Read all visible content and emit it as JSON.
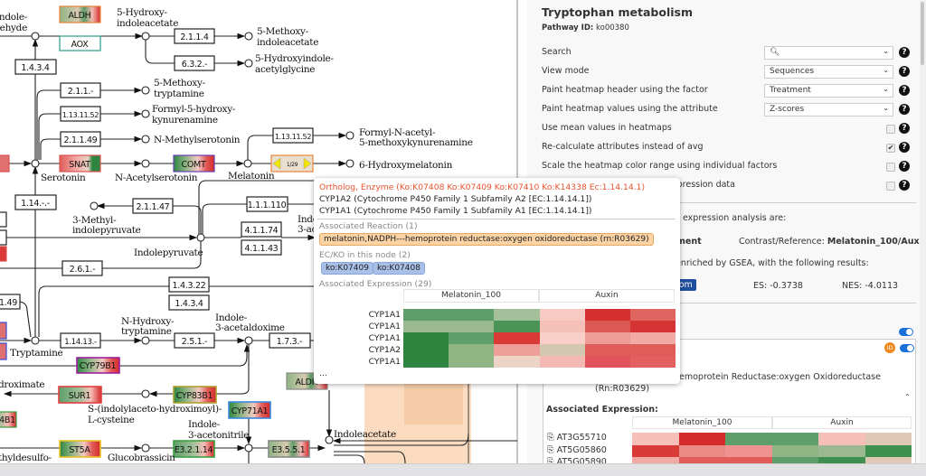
{
  "map": {
    "enzymes": [
      "ALDH",
      "AOX",
      "1.4.3.4",
      "2.1.1.4",
      "6.3.2.-",
      "2.1.1.-",
      "1.13.11.52",
      "2.1.1.49",
      "SNAT",
      "COMT",
      "1.13.11.52",
      "1/29",
      "1.14.-.-",
      "2.1.1.47",
      "1.1.1.110",
      "4.1.1.74",
      "4.1.1.43",
      "2.6.1.-",
      "1.4.3.22",
      "1.4.3.4",
      "1.14.13.-",
      "2.5.1.-",
      "1.7.3.-",
      "CYP79B1",
      "SUR1",
      "CYP83B1",
      "CYP71A1",
      "ST5A",
      "E3.2.1.14",
      "E3.5.5.1",
      "ALDH",
      "4B1",
      "1.49"
    ],
    "compounds": [
      [
        "roxyindole-",
        "dehyde"
      ],
      [
        "5-Hydroxy-",
        "indoleacetate"
      ],
      [
        "5-Methoxy-",
        "indoleacetate"
      ],
      [
        "5-Hydroxyindole-",
        "acetylglycine"
      ],
      [
        "5-Methoxy-",
        "tryptamine"
      ],
      [
        "Formyl-5-hydroxy-",
        "kynurenamine"
      ],
      [
        "N-Methylserotonin"
      ],
      [
        "Serotonin"
      ],
      [
        "N-Acetylserotonin"
      ],
      [
        "Melatonin"
      ],
      [
        "Formyl-N-acetyl-",
        "5-methoxykynurenamine"
      ],
      [
        "6-Hydroxymelatonin"
      ],
      [
        "3-Methyl-",
        "indolepyruvate"
      ],
      [
        "Indolepyruvate"
      ],
      [
        "Indo",
        "3-ac"
      ],
      [
        "N-Hydroxy-",
        "tryptamine"
      ],
      [
        "Indole-",
        "3-acetaldoxime"
      ],
      [
        "Tryptamine"
      ],
      [
        "droximate"
      ],
      [
        "S-(indolylaceto-hydroximoyl)-",
        "L-cysteine"
      ],
      [
        "Indole-",
        "3-acetonitrile"
      ],
      [
        "thyldesulfo-"
      ],
      [
        "Glucobrassicin"
      ],
      [
        "Indoleacetate"
      ]
    ]
  },
  "tooltip": {
    "header": "Ortholog, Enzyme  (Ko:K07408 Ko:K07409 Ko:K07410 Ko:K14338 Ec:1.14.14.1)",
    "genes": [
      "CYP1A2 (Cytochrome P450 Family 1 Subfamily A2 [EC:1.14.14.1])",
      "CYP1A1 (Cytochrome P450 Family 1 Subfamily A1 [EC:1.14.14.1])"
    ],
    "reaction_title": "Associated Reaction (1)",
    "reaction": "melatonin,NADPH---hemoprotein reductase:oxygen oxidoreductase (rn:R03629)",
    "ecko_title": "EC/KO in this node (2)",
    "ecko": [
      "ko:K07409",
      "ko:K07408"
    ],
    "expression_title": "Associated Expression (29)",
    "groups": [
      "Melatonin_100",
      "Auxin"
    ],
    "rows": [
      "CYP1A1",
      "CYP1A1",
      "CYP1A1",
      "CYP1A2",
      "CYP1A1"
    ],
    "heatmap": [
      [
        "#5e9e6a",
        "#5e9e6a",
        "#a3c09a",
        "#f7cbc3",
        "#d62f2f",
        "#e06560"
      ],
      [
        "#9ab990",
        "#9ab990",
        "#4a9458",
        "#f5c0b8",
        "#dc5a55",
        "#d63434"
      ],
      [
        "#2e8540",
        "#5e9e6a",
        "#d93a36",
        "#f8d0c8",
        "#ed9c96",
        "#f2aaa4"
      ],
      [
        "#2e8540",
        "#8fb585",
        "#ef9f9a",
        "#d4c7b0",
        "#e05c58",
        "#e05c58"
      ],
      [
        "#2e8540",
        "#8fb585",
        "#ecd4c7",
        "#f3b9b3",
        "#e0535a",
        "#e26060"
      ]
    ],
    "more": "..."
  },
  "panel": {
    "title": "Tryptophan metabolism",
    "pathway_id_label": "Pathway ID:",
    "pathway_id": "ko00380",
    "settings": [
      {
        "label": "Search",
        "type": "select",
        "value": "",
        "icon": "search-icon"
      },
      {
        "label": "View mode",
        "type": "select",
        "value": "Sequences"
      },
      {
        "label": "Paint heatmap header using the factor",
        "type": "select",
        "value": "Treatment"
      },
      {
        "label": "Paint heatmap values using the attribute",
        "type": "select",
        "value": "Z-scores"
      },
      {
        "label": "Use mean values in heatmaps",
        "type": "checkbox",
        "checked": false
      },
      {
        "label": "Re-calculate attributes instead of avg",
        "type": "checkbox",
        "checked": true
      },
      {
        "label": "Scale the heatmap color range using individual factors",
        "type": "checkbox",
        "checked": false
      },
      {
        "label": "xpression data",
        "type": "checkbox",
        "checked": false
      }
    ],
    "analysis_intro": "expression analysis are:",
    "factor_fragment": "ment",
    "contrast_label": "Contrast/Reference:",
    "contrast_value": "Melatonin_100/Auxin",
    "gsea_text": "enriched by GSEA, with the following results:",
    "badge": "tom",
    "es": "ES: -0.3738",
    "nes": "NES: -4.0113",
    "card": {
      "id_badge": "ID",
      "reaction_fragment": "emoprotein Reductase:oxygen Oxidoreductase",
      "reaction_id": "(Rn:R03629)",
      "expression_title": "Associated Expression:",
      "groups": [
        "Melatonin_100",
        "Auxin"
      ],
      "rows": [
        "AT3G55710",
        "AT5G05860",
        "AT5G05890"
      ],
      "heatmap": [
        [
          "#f6bfb8",
          "#d42a2a",
          "#5e9e6a",
          "#5e9e6a",
          "#f6bfb8",
          "#dfc9b6"
        ],
        [
          "#d93b36",
          "#ea8a84",
          "#ee9390",
          "#8fb585",
          "#9ab990",
          "#3f8f51"
        ],
        [
          "#f2aaa4",
          "#e05c58",
          "#e05c58",
          "#5e9e6a",
          "#3f8f51",
          "#dfc9b6"
        ]
      ]
    }
  },
  "colors": {
    "accent": "#1a6fd8",
    "tooltip_header": "#e8522e",
    "reaction_chip": "#fbd3a4",
    "ko_chip": "#a9c1e8",
    "id_badge": "#f0861e"
  }
}
